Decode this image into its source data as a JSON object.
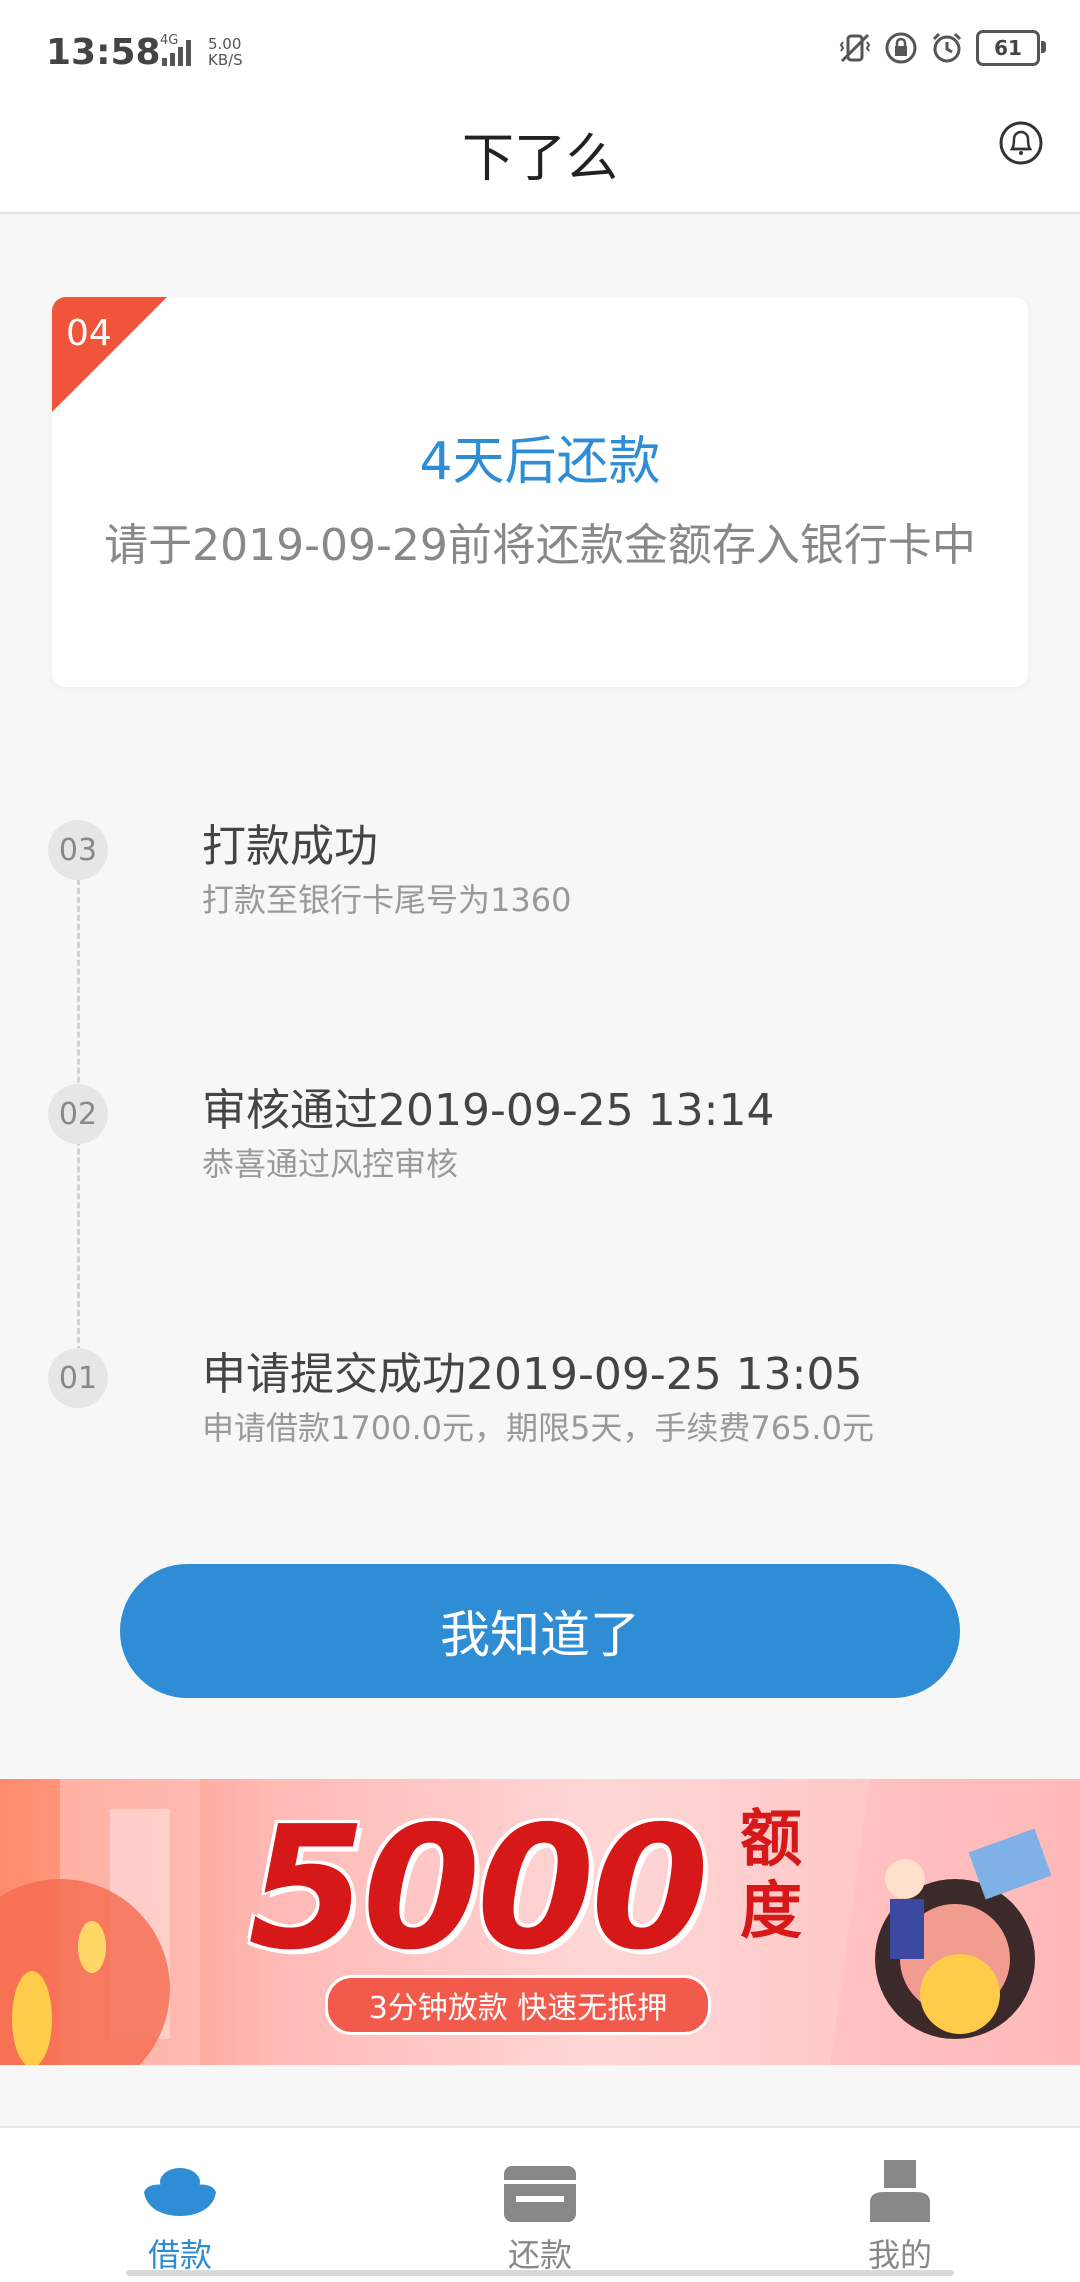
{
  "status_bar": {
    "time": "13:58",
    "network": "4G",
    "speed": "5.00\nKB/S",
    "battery": "61",
    "icons": [
      "vibrate-icon",
      "lock-icon",
      "alarm-icon",
      "battery-icon"
    ]
  },
  "header": {
    "title": "下了么",
    "right_icon": "bell-icon"
  },
  "current_step": {
    "number": "04",
    "title": "4天后还款",
    "subtitle": "请于2019-09-29前将还款金额存入银行卡中"
  },
  "timeline": [
    {
      "number": "03",
      "title": "打款成功",
      "desc": "打款至银行卡尾号为1360"
    },
    {
      "number": "02",
      "title": "审核通过2019-09-25 13:14",
      "desc": "恭喜通过风控审核"
    },
    {
      "number": "01",
      "title": "申请提交成功2019-09-25 13:05",
      "desc": "申请借款1700.0元，期限5天，手续费765.0元"
    }
  ],
  "ack_button": "我知道了",
  "banner": {
    "amount": "5000",
    "label": "额度",
    "tagline": "3分钟放款 快速无抵押"
  },
  "tabs": [
    {
      "label": "借款",
      "icon": "ingot-icon",
      "active": true
    },
    {
      "label": "还款",
      "icon": "card-icon",
      "active": false
    },
    {
      "label": "我的",
      "icon": "user-icon",
      "active": false
    }
  ],
  "colors": {
    "accent": "#2e8dd4",
    "corner": "#f0543a",
    "banner_red": "#d61818"
  }
}
